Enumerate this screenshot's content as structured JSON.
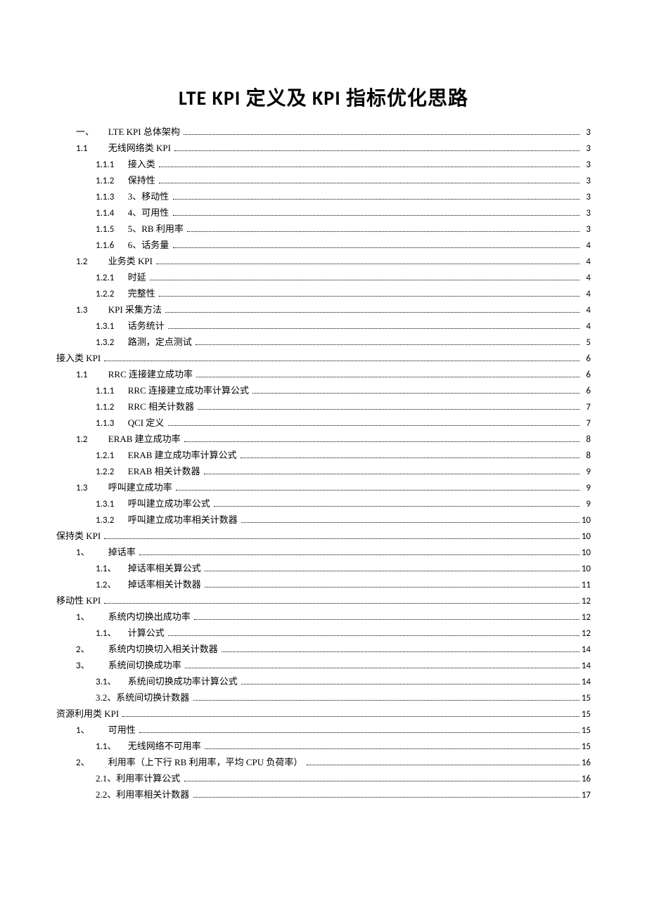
{
  "title": "LTE KPI 定义及 KPI 指标优化思路",
  "toc": [
    {
      "indent": 1,
      "num": "一、",
      "label": "LTE KPI 总体架构",
      "page": "3"
    },
    {
      "indent": 1,
      "num": "1.1",
      "label": "无线网络类 KPI",
      "page": "3"
    },
    {
      "indent": 2,
      "num": "1.1.1",
      "label": "接入类",
      "page": "3"
    },
    {
      "indent": 2,
      "num": "1.1.2",
      "label": "保持性",
      "page": "3"
    },
    {
      "indent": 2,
      "num": "1.1.3",
      "label": "3、移动性",
      "page": "3"
    },
    {
      "indent": 2,
      "num": "1.1.4",
      "label": "4、可用性",
      "page": "3"
    },
    {
      "indent": 2,
      "num": "1.1.5",
      "label": "5、RB 利用率",
      "page": "3"
    },
    {
      "indent": 2,
      "num": "1.1.6",
      "label": "6、话务量",
      "page": "4"
    },
    {
      "indent": 1,
      "num": "1.2",
      "label": "业务类 KPI",
      "page": "4"
    },
    {
      "indent": 2,
      "num": "1.2.1",
      "label": "时延",
      "page": "4"
    },
    {
      "indent": 2,
      "num": "1.2.2",
      "label": "完整性",
      "page": "4"
    },
    {
      "indent": 1,
      "num": "1.3",
      "label": "KPI 采集方法",
      "page": "4"
    },
    {
      "indent": 2,
      "num": "1.3.1",
      "label": "话务统计",
      "page": "4"
    },
    {
      "indent": 2,
      "num": "1.3.2",
      "label": "路测，定点测试",
      "page": "5"
    },
    {
      "indent": 0,
      "num": "",
      "label": "接入类 KPI",
      "page": "6"
    },
    {
      "indent": 1,
      "num": "1.1",
      "label": "RRC 连接建立成功率",
      "page": "6"
    },
    {
      "indent": 2,
      "num": "1.1.1",
      "label": "RRC 连接建立成功率计算公式",
      "page": "6"
    },
    {
      "indent": 2,
      "num": "1.1.2",
      "label": "RRC 相关计数器",
      "page": "7"
    },
    {
      "indent": 2,
      "num": "1.1.3",
      "label": "QCI 定义",
      "page": "7"
    },
    {
      "indent": 1,
      "num": "1.2",
      "label": "ERAB 建立成功率",
      "page": "8"
    },
    {
      "indent": 2,
      "num": "1.2.1",
      "label": "ERAB 建立成功率计算公式",
      "page": "8"
    },
    {
      "indent": 2,
      "num": "1.2.2",
      "label": "ERAB 相关计数器",
      "page": "9"
    },
    {
      "indent": 1,
      "num": "1.3",
      "label": "呼叫建立成功率",
      "page": "9"
    },
    {
      "indent": 2,
      "num": "1.3.1",
      "label": "呼叫建立成功率公式",
      "page": "9"
    },
    {
      "indent": 2,
      "num": "1.3.2",
      "label": "呼叫建立成功率相关计数器",
      "page": "10"
    },
    {
      "indent": 0,
      "num": "",
      "label": "保持类 KPI",
      "page": "10"
    },
    {
      "indent": 1,
      "num": "1、",
      "label": "掉话率",
      "page": "10"
    },
    {
      "indent": 2,
      "num": "1.1、",
      "label": "掉话率相关算公式",
      "page": "10"
    },
    {
      "indent": 2,
      "num": "1.2、",
      "label": "掉话率相关计数器",
      "page": "11"
    },
    {
      "indent": 0,
      "num": "",
      "label": "移动性 KPI",
      "page": "12"
    },
    {
      "indent": 1,
      "num": "1、",
      "label": "系统内切换出成功率",
      "page": "12"
    },
    {
      "indent": 2,
      "num": "1.1、",
      "label": "计算公式",
      "page": "12"
    },
    {
      "indent": 1,
      "num": "2、",
      "label": "系统内切换切入相关计数器",
      "page": "14"
    },
    {
      "indent": 1,
      "num": "3、",
      "label": "系统间切换成功率",
      "page": "14"
    },
    {
      "indent": 2,
      "num": "3.1、",
      "label": "系统间切换成功率计算公式",
      "page": "14"
    },
    {
      "indent": 2,
      "num": "",
      "label": "3.2、系统间切换计数器",
      "page": "15"
    },
    {
      "indent": 0,
      "num": "",
      "label": "资源利用类 KPI",
      "page": "15"
    },
    {
      "indent": 1,
      "num": "1、",
      "label": "可用性",
      "page": "15"
    },
    {
      "indent": 2,
      "num": "1.1、",
      "label": "无线网络不可用率",
      "page": "15"
    },
    {
      "indent": 1,
      "num": "2、",
      "label": "利用率（上下行 RB 利用率，平均 CPU 负荷率）",
      "page": "16"
    },
    {
      "indent": 2,
      "num": "",
      "label": "2.1、利用率计算公式",
      "page": "16"
    },
    {
      "indent": 2,
      "num": "",
      "label": "2.2、利用率相关计数器",
      "page": "17"
    }
  ]
}
